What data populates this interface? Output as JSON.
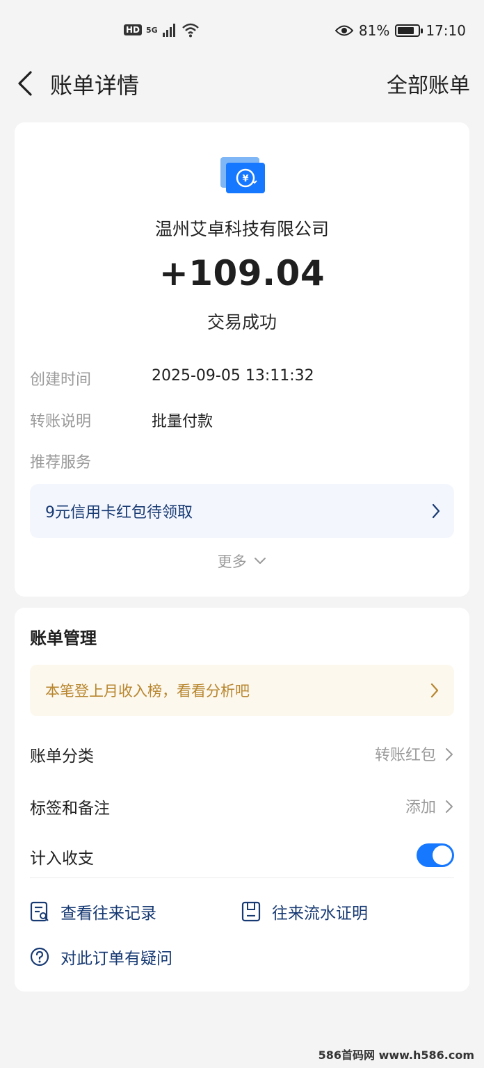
{
  "status_bar": {
    "hd": "HD",
    "network": "5G",
    "battery_percent": "81%",
    "battery_level": 0.81,
    "time": "17:10"
  },
  "header": {
    "title": "账单详情",
    "right_link": "全部账单"
  },
  "transaction": {
    "merchant": "温州艾卓科技有限公司",
    "amount": "+109.04",
    "status": "交易成功",
    "fields": [
      {
        "label": "创建时间",
        "value": "2025-09-05 13:11:32"
      },
      {
        "label": "转账说明",
        "value": "批量付款"
      },
      {
        "label": "推荐服务",
        "value": ""
      }
    ],
    "promo": "9元信用卡红包待领取",
    "more": "更多"
  },
  "management": {
    "title": "账单管理",
    "notice": "本笔登上月收入榜，看看分析吧",
    "rows": [
      {
        "label": "账单分类",
        "value": "转账红包"
      },
      {
        "label": "标签和备注",
        "value": "添加"
      },
      {
        "label": "计入收支",
        "value": ""
      }
    ],
    "toggle_on": true,
    "links": {
      "history": "查看往来记录",
      "statement": "往来流水证明",
      "question": "对此订单有疑问"
    }
  },
  "watermark": "586首码网 www.h586.com",
  "colors": {
    "accent": "#1677ff",
    "link": "#173a73",
    "notice_text": "#b7862e"
  }
}
